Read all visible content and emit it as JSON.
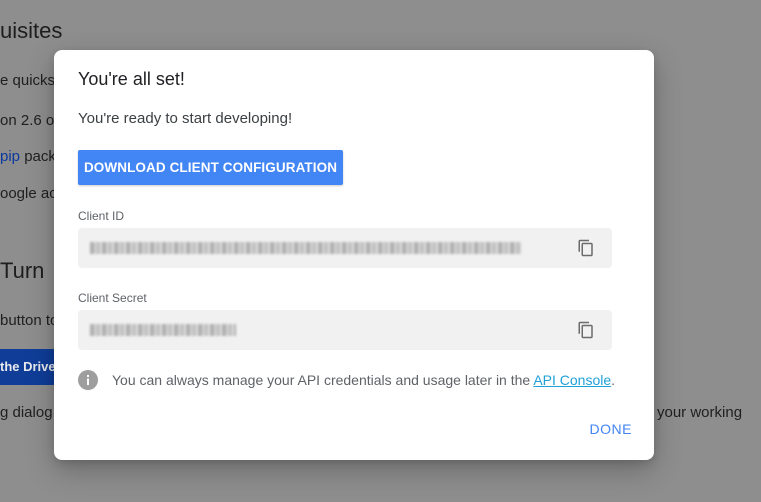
{
  "background": {
    "heading": "uisites",
    "lines": [
      "e quickst",
      "on 2.6 o",
      "pip pack",
      "oogle acc"
    ],
    "link_text": "pip",
    "turn_heading": "Turn",
    "line_button": "button to",
    "enable_button": "the Drive",
    "line_dialog": "g dialog",
    "right_text": "your working"
  },
  "dialog": {
    "title": "You're all set!",
    "subtitle": "You're ready to start developing!",
    "download_button": "DOWNLOAD CLIENT CONFIGURATION",
    "client_id_label": "Client ID",
    "client_secret_label": "Client Secret",
    "info_text": "You can always manage your API credentials and usage later in the ",
    "info_link": "API Console",
    "info_suffix": ".",
    "done_button": "DONE"
  },
  "colors": {
    "primary": "#4285f4",
    "link": "#1fa0d9",
    "field_bg": "#f1f1f1",
    "overlay": "#8e8e8e"
  },
  "icons": {
    "copy": "copy-icon",
    "info": "info-icon"
  }
}
